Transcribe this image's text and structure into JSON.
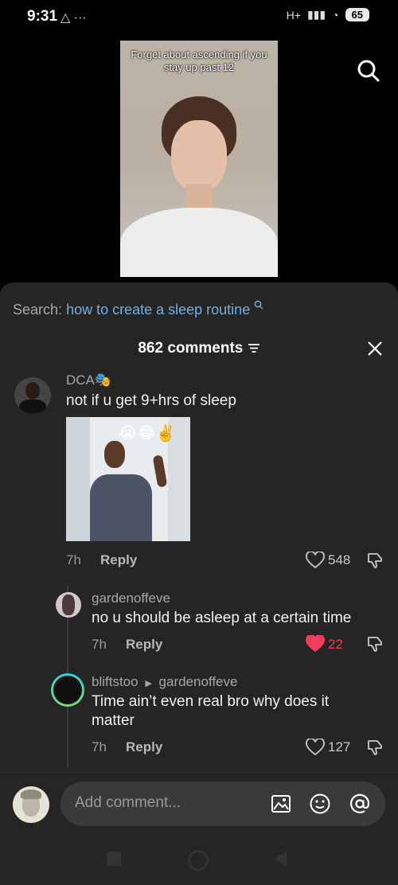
{
  "status": {
    "time": "9:31",
    "icons": "△ ···",
    "network": "H+",
    "battery": "65"
  },
  "video": {
    "caption": "Forget about ascending if you stay up past 12"
  },
  "search": {
    "label": "Search:",
    "query": "how to create a sleep routine"
  },
  "comments_header": {
    "title": "862 comments"
  },
  "comments": [
    {
      "user": "DCA🎭",
      "text": "not if u get 9+hrs of sleep",
      "time": "7h",
      "reply": "Reply",
      "likes": "548",
      "liked": false
    },
    {
      "user": "gardenoffeve",
      "text": "no u should be asleep at a certain time",
      "time": "7h",
      "reply": "Reply",
      "likes": "22",
      "liked": true
    },
    {
      "user": "bliftstoo",
      "reply_to": "gardenoffeve",
      "text": "Time ain’t even real bro why does it matter",
      "time": "7h",
      "reply": "Reply",
      "likes": "127",
      "liked": false
    }
  ],
  "input": {
    "placeholder": "Add comment..."
  },
  "colors": {
    "accent_blue": "#6fb0e6",
    "like_red": "#f23d5a",
    "sheet_bg": "#252525"
  }
}
